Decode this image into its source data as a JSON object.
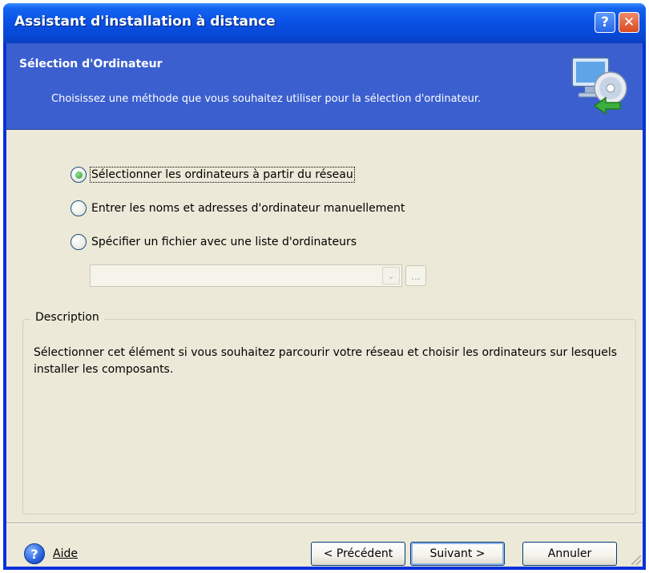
{
  "window": {
    "title": "Assistant d'installation à distance",
    "help_button": "?",
    "close_button": "✕"
  },
  "header": {
    "title": "Sélection d'Ordinateur",
    "subtitle": "Choisissez une méthode que vous souhaitez utiliser pour la sélection d'ordinateur.",
    "icon": "computer-disc-icon"
  },
  "options": [
    {
      "label": "Sélectionner les ordinateurs à partir du réseau",
      "checked": true
    },
    {
      "label": "Entrer les noms et adresses d'ordinateur manuellement",
      "checked": false
    },
    {
      "label": "Spécifier un fichier avec une liste d'ordinateurs",
      "checked": false
    }
  ],
  "file_combo": {
    "value": "",
    "arrow": "⌄",
    "browse_label": "..."
  },
  "description": {
    "legend": "Description",
    "text": "Sélectionner cet élément si vous souhaitez parcourir votre réseau et choisir les ordinateurs sur lesquels installer les composants."
  },
  "footer": {
    "help_label": "Aide",
    "help_icon_glyph": "?",
    "prev_label": "< Précédent",
    "next_label": "Suivant >",
    "cancel_label": "Annuler"
  },
  "colors": {
    "titlebar": "#0a52e6",
    "header": "#3b5fcf",
    "client": "#ece9d8",
    "radio_selected": "#2d9e2d"
  }
}
